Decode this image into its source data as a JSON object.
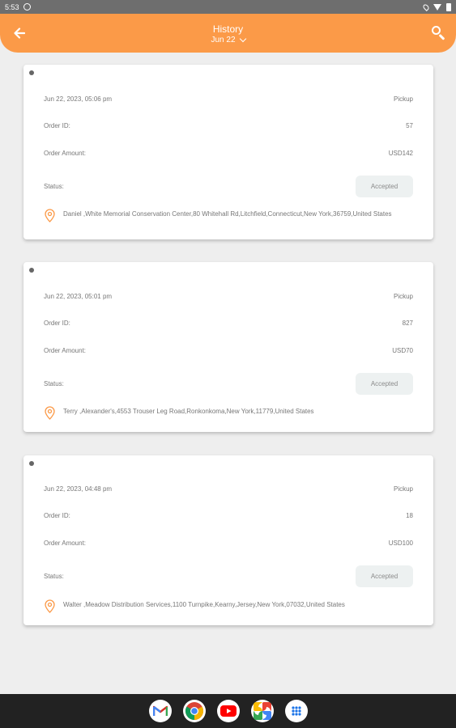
{
  "status_bar": {
    "time": "5:53"
  },
  "header": {
    "title": "History",
    "date": "Jun 22"
  },
  "orders": [
    {
      "datetime": "Jun 22, 2023, 05:06 pm",
      "type": "Pickup",
      "order_id_label": "Order ID:",
      "order_id": "57",
      "amount_label": "Order Amount:",
      "amount": "USD142",
      "status_label": "Status:",
      "status": "Accepted",
      "address": "Daniel ,White Memorial Conservation Center,80 Whitehall Rd,Litchfield,Connecticut,New York,36759,United States"
    },
    {
      "datetime": "Jun 22, 2023, 05:01 pm",
      "type": "Pickup",
      "order_id_label": "Order ID:",
      "order_id": "827",
      "amount_label": "Order Amount:",
      "amount": "USD70",
      "status_label": "Status:",
      "status": "Accepted",
      "address": "Terry ,Alexander's,4553 Trouser Leg Road,Ronkonkoma,New York,11779,United States"
    },
    {
      "datetime": "Jun 22, 2023, 04:48 pm",
      "type": "Pickup",
      "order_id_label": "Order ID:",
      "order_id": "18",
      "amount_label": "Order Amount:",
      "amount": "USD100",
      "status_label": "Status:",
      "status": "Accepted",
      "address": "Walter ,Meadow Distribution Services,1100 Turnpike,Kearny,Jersey,New York,07032,United States"
    }
  ],
  "colors": {
    "accent": "#fb9a48",
    "pill_bg": "#edf1f1"
  },
  "dock": {
    "apps": [
      "gmail-icon",
      "chrome-icon",
      "youtube-icon",
      "photos-icon",
      "app-drawer-icon"
    ]
  }
}
